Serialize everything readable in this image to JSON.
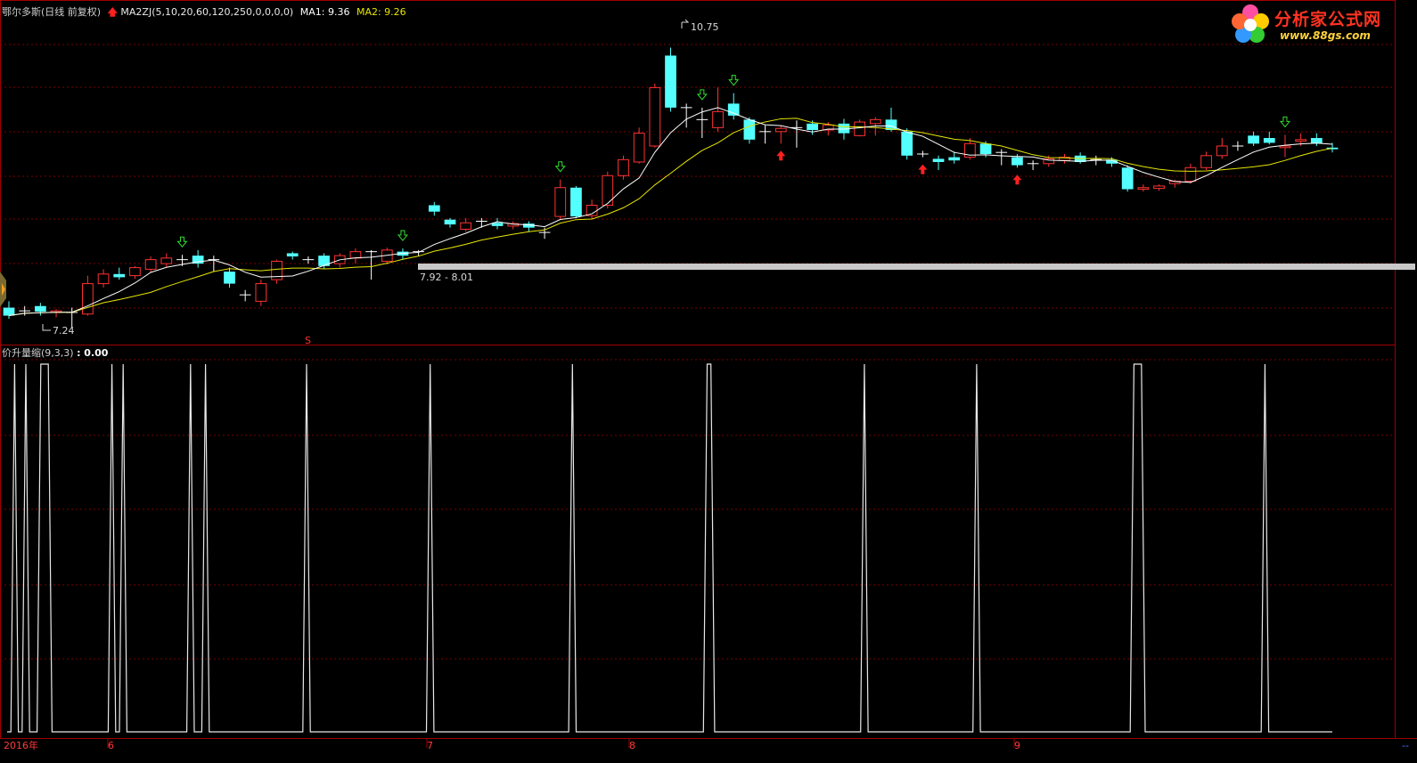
{
  "header": {
    "stock_title": "鄂尔多斯(日线 前复权)",
    "indicator_name": "MA2ZJ(5,10,20,60,120,250,0,0,0,0)",
    "ma1_label": "MA1: 9.36",
    "ma2_label": "MA2: 9.26"
  },
  "subchart": {
    "title": "价升量缩(9,3,3)",
    "value_label": ": 0.00"
  },
  "price_labels": {
    "high": "10.75",
    "low": "7.24",
    "zone": "7.92 - 8.01",
    "marker": "S"
  },
  "time_axis": {
    "year_label": "2016年",
    "months": [
      "6",
      "7",
      "8",
      "9"
    ],
    "corner_label": "--"
  },
  "logo": {
    "name": "分析家公式网",
    "url": "www.88gs.com"
  },
  "colors": {
    "up": "#ff3232",
    "down": "#54ffff",
    "ma1": "#ffffff",
    "ma2": "#e6e600",
    "grid": "#7a0000",
    "border": "#a00000",
    "indicator": "#ffffff",
    "band": "#c8c8c8",
    "buy_arrow": "#ff2020",
    "sell_arrow": "#33dd33"
  },
  "chart_data": {
    "type": "candlestick",
    "period": "daily",
    "high_label": 10.75,
    "low_label": 7.24,
    "zone": [
      7.92,
      8.01
    ],
    "ma_values": {
      "MA1": 9.36,
      "MA2": 9.26
    },
    "indicator": {
      "name": "价升量缩(9,3,3)",
      "current": 0.0,
      "values": [
        0,
        0,
        1,
        0,
        0,
        1,
        0,
        0,
        0,
        1,
        1,
        1,
        0,
        0,
        0,
        0,
        0,
        0,
        0,
        0,
        0,
        0,
        0,
        0,
        0,
        0,
        0,
        0,
        1,
        0,
        0,
        1,
        0,
        0,
        0,
        0,
        0,
        0,
        0,
        0,
        0,
        0,
        0,
        0,
        0,
        0,
        0,
        0,
        0,
        1,
        0,
        0,
        0,
        1,
        0,
        0,
        0,
        0,
        0,
        0,
        0,
        0,
        0,
        0,
        0,
        0,
        0,
        0,
        0,
        0,
        0,
        0,
        0,
        0,
        0,
        0,
        0,
        0,
        0,
        0,
        1,
        0,
        0,
        0,
        0,
        0,
        0,
        0,
        0,
        0,
        0,
        0,
        0,
        0,
        0,
        0,
        0,
        0,
        0,
        0,
        0,
        0,
        0,
        0,
        0,
        0,
        0,
        0,
        0,
        0,
        0,
        0,
        0,
        1,
        0,
        0,
        0,
        0,
        0,
        0,
        0,
        0,
        0,
        0,
        0,
        0,
        0,
        0,
        0,
        0,
        0,
        0,
        0,
        0,
        0,
        0,
        0,
        0,
        0,
        0,
        0,
        0,
        0,
        0,
        0,
        0,
        0,
        0,
        0,
        0,
        0,
        1,
        0,
        0,
        0,
        0,
        0,
        0,
        0,
        0,
        0,
        0,
        0,
        0,
        0,
        0,
        0,
        0,
        0,
        0,
        0,
        0,
        0,
        0,
        0,
        0,
        0,
        0,
        0,
        0,
        0,
        0,
        0,
        0,
        0,
        0,
        0,
        1,
        1,
        0,
        0,
        0,
        0,
        0,
        0,
        0,
        0,
        0,
        0,
        0,
        0,
        0,
        0,
        0,
        0,
        0,
        0,
        0,
        0,
        0,
        0,
        0,
        0,
        0,
        0,
        0,
        0,
        0,
        0,
        0,
        0,
        0,
        0,
        0,
        0,
        0,
        0,
        0,
        0,
        1,
        0,
        0,
        0,
        0,
        0,
        0,
        0,
        0,
        0,
        0,
        0,
        0,
        0,
        0,
        0,
        0,
        0,
        0,
        0,
        0,
        0,
        0,
        0,
        0,
        0,
        0,
        0,
        0,
        0,
        1,
        0,
        0,
        0,
        0,
        0,
        0,
        0,
        0,
        0,
        0,
        0,
        0,
        0,
        0,
        0,
        0,
        0,
        0,
        0,
        0,
        0,
        0,
        0,
        0,
        0,
        0,
        0,
        0,
        0,
        0,
        0,
        0,
        0,
        0,
        0,
        0,
        0,
        0,
        0,
        0,
        0,
        1,
        1,
        1,
        0,
        0,
        0,
        0,
        0,
        0,
        0,
        0,
        0,
        0,
        0,
        0,
        0,
        0,
        0,
        0,
        0,
        0,
        0,
        0,
        0,
        0,
        0,
        0,
        0,
        0,
        0,
        0,
        0,
        0,
        0,
        0,
        1,
        0,
        0,
        0,
        0,
        0,
        0,
        0,
        0,
        0,
        0,
        0,
        0,
        0,
        0,
        0,
        0,
        0,
        0
      ]
    },
    "candles": [
      {
        "o": 7.5,
        "h": 7.58,
        "l": 7.36,
        "c": 7.4,
        "s": "down"
      },
      {
        "o": 7.45,
        "h": 7.52,
        "l": 7.4,
        "c": 7.46,
        "s": "flat"
      },
      {
        "o": 7.52,
        "h": 7.56,
        "l": 7.4,
        "c": 7.45,
        "s": "down"
      },
      {
        "o": 7.44,
        "h": 7.48,
        "l": 7.38,
        "c": 7.46,
        "s": "up"
      },
      {
        "o": 7.42,
        "h": 7.5,
        "l": 7.24,
        "c": 7.44,
        "s": "flat"
      },
      {
        "o": 7.42,
        "h": 7.9,
        "l": 7.4,
        "c": 7.8,
        "s": "up"
      },
      {
        "o": 7.8,
        "h": 7.98,
        "l": 7.75,
        "c": 7.92,
        "s": "up"
      },
      {
        "o": 7.92,
        "h": 8.0,
        "l": 7.85,
        "c": 7.88,
        "s": "down"
      },
      {
        "o": 7.9,
        "h": 8.02,
        "l": 7.86,
        "c": 8.0,
        "s": "up"
      },
      {
        "o": 7.98,
        "h": 8.14,
        "l": 7.94,
        "c": 8.1,
        "s": "up"
      },
      {
        "o": 8.05,
        "h": 8.18,
        "l": 8.0,
        "c": 8.12,
        "s": "up"
      },
      {
        "o": 8.1,
        "h": 8.16,
        "l": 8.02,
        "c": 8.1,
        "s": "flat"
      },
      {
        "o": 8.15,
        "h": 8.22,
        "l": 8.0,
        "c": 8.05,
        "s": "down"
      },
      {
        "o": 8.05,
        "h": 8.15,
        "l": 7.95,
        "c": 8.1,
        "s": "flat"
      },
      {
        "o": 7.95,
        "h": 8.0,
        "l": 7.75,
        "c": 7.8,
        "s": "down"
      },
      {
        "o": 7.65,
        "h": 7.72,
        "l": 7.58,
        "c": 7.66,
        "s": "flat"
      },
      {
        "o": 7.58,
        "h": 7.85,
        "l": 7.52,
        "c": 7.8,
        "s": "up"
      },
      {
        "o": 7.85,
        "h": 8.1,
        "l": 7.8,
        "c": 8.08,
        "s": "up"
      },
      {
        "o": 8.18,
        "h": 8.2,
        "l": 8.1,
        "c": 8.14,
        "s": "down"
      },
      {
        "o": 8.1,
        "h": 8.14,
        "l": 8.05,
        "c": 8.1,
        "s": "flat"
      },
      {
        "o": 8.15,
        "h": 8.18,
        "l": 7.98,
        "c": 8.02,
        "s": "down"
      },
      {
        "o": 8.05,
        "h": 8.18,
        "l": 8.0,
        "c": 8.15,
        "s": "up"
      },
      {
        "o": 8.12,
        "h": 8.24,
        "l": 8.05,
        "c": 8.2,
        "s": "up"
      },
      {
        "o": 8.2,
        "h": 8.22,
        "l": 7.85,
        "c": 8.18,
        "s": "flat"
      },
      {
        "o": 8.08,
        "h": 8.25,
        "l": 8.04,
        "c": 8.22,
        "s": "up"
      },
      {
        "o": 8.2,
        "h": 8.24,
        "l": 8.1,
        "c": 8.15,
        "s": "down"
      },
      {
        "o": 8.18,
        "h": 8.22,
        "l": 8.14,
        "c": 8.2,
        "s": "flat"
      },
      {
        "o": 8.78,
        "h": 8.82,
        "l": 8.65,
        "c": 8.7,
        "s": "down"
      },
      {
        "o": 8.6,
        "h": 8.62,
        "l": 8.5,
        "c": 8.54,
        "s": "down"
      },
      {
        "o": 8.48,
        "h": 8.62,
        "l": 8.45,
        "c": 8.56,
        "s": "up"
      },
      {
        "o": 8.58,
        "h": 8.62,
        "l": 8.5,
        "c": 8.55,
        "s": "flat"
      },
      {
        "o": 8.56,
        "h": 8.62,
        "l": 8.48,
        "c": 8.52,
        "s": "down"
      },
      {
        "o": 8.52,
        "h": 8.58,
        "l": 8.48,
        "c": 8.55,
        "s": "up"
      },
      {
        "o": 8.55,
        "h": 8.58,
        "l": 8.45,
        "c": 8.5,
        "s": "down"
      },
      {
        "o": 8.44,
        "h": 8.5,
        "l": 8.36,
        "c": 8.44,
        "s": "flat"
      },
      {
        "o": 8.64,
        "h": 9.1,
        "l": 8.6,
        "c": 9.0,
        "s": "up"
      },
      {
        "o": 9.0,
        "h": 9.02,
        "l": 8.62,
        "c": 8.64,
        "s": "down"
      },
      {
        "o": 8.65,
        "h": 8.85,
        "l": 8.6,
        "c": 8.78,
        "s": "up"
      },
      {
        "o": 8.78,
        "h": 9.2,
        "l": 8.74,
        "c": 9.15,
        "s": "up"
      },
      {
        "o": 9.15,
        "h": 9.4,
        "l": 9.1,
        "c": 9.35,
        "s": "up"
      },
      {
        "o": 9.32,
        "h": 9.75,
        "l": 9.3,
        "c": 9.68,
        "s": "up"
      },
      {
        "o": 9.52,
        "h": 10.3,
        "l": 9.5,
        "c": 10.25,
        "s": "up"
      },
      {
        "o": 10.65,
        "h": 10.75,
        "l": 9.95,
        "c": 10.0,
        "s": "down"
      },
      {
        "o": 10.0,
        "h": 10.05,
        "l": 9.75,
        "c": 10.0,
        "s": "flat"
      },
      {
        "o": 9.85,
        "h": 10.0,
        "l": 9.62,
        "c": 9.8,
        "s": "flat"
      },
      {
        "o": 9.75,
        "h": 10.25,
        "l": 9.7,
        "c": 9.95,
        "s": "up"
      },
      {
        "o": 10.05,
        "h": 10.18,
        "l": 9.85,
        "c": 9.9,
        "s": "down"
      },
      {
        "o": 9.85,
        "h": 9.88,
        "l": 9.55,
        "c": 9.6,
        "s": "down"
      },
      {
        "o": 9.7,
        "h": 9.78,
        "l": 9.55,
        "c": 9.68,
        "s": "flat"
      },
      {
        "o": 9.7,
        "h": 9.78,
        "l": 9.55,
        "c": 9.74,
        "s": "up"
      },
      {
        "o": 9.75,
        "h": 9.84,
        "l": 9.5,
        "c": 9.74,
        "s": "flat"
      },
      {
        "o": 9.8,
        "h": 9.84,
        "l": 9.66,
        "c": 9.72,
        "s": "down"
      },
      {
        "o": 9.72,
        "h": 9.82,
        "l": 9.65,
        "c": 9.78,
        "s": "up"
      },
      {
        "o": 9.8,
        "h": 9.86,
        "l": 9.6,
        "c": 9.68,
        "s": "down"
      },
      {
        "o": 9.65,
        "h": 9.85,
        "l": 9.64,
        "c": 9.82,
        "s": "up"
      },
      {
        "o": 9.8,
        "h": 9.88,
        "l": 9.65,
        "c": 9.85,
        "s": "up"
      },
      {
        "o": 9.85,
        "h": 10.0,
        "l": 9.7,
        "c": 9.72,
        "s": "down"
      },
      {
        "o": 9.7,
        "h": 9.74,
        "l": 9.35,
        "c": 9.4,
        "s": "down"
      },
      {
        "o": 9.42,
        "h": 9.46,
        "l": 9.38,
        "c": 9.42,
        "s": "flat"
      },
      {
        "o": 9.36,
        "h": 9.4,
        "l": 9.22,
        "c": 9.32,
        "s": "down"
      },
      {
        "o": 9.38,
        "h": 9.45,
        "l": 9.3,
        "c": 9.34,
        "s": "down"
      },
      {
        "o": 9.38,
        "h": 9.62,
        "l": 9.35,
        "c": 9.55,
        "s": "up"
      },
      {
        "o": 9.55,
        "h": 9.58,
        "l": 9.38,
        "c": 9.42,
        "s": "down"
      },
      {
        "o": 9.44,
        "h": 9.48,
        "l": 9.28,
        "c": 9.36,
        "s": "flat"
      },
      {
        "o": 9.38,
        "h": 9.42,
        "l": 9.25,
        "c": 9.28,
        "s": "down"
      },
      {
        "o": 9.3,
        "h": 9.34,
        "l": 9.22,
        "c": 9.3,
        "s": "flat"
      },
      {
        "o": 9.3,
        "h": 9.4,
        "l": 9.26,
        "c": 9.36,
        "s": "up"
      },
      {
        "o": 9.34,
        "h": 9.42,
        "l": 9.3,
        "c": 9.38,
        "s": "up"
      },
      {
        "o": 9.4,
        "h": 9.44,
        "l": 9.3,
        "c": 9.32,
        "s": "down"
      },
      {
        "o": 9.33,
        "h": 9.4,
        "l": 9.28,
        "c": 9.35,
        "s": "flat"
      },
      {
        "o": 9.35,
        "h": 9.38,
        "l": 9.26,
        "c": 9.3,
        "s": "down"
      },
      {
        "o": 9.25,
        "h": 9.28,
        "l": 8.95,
        "c": 8.98,
        "s": "down"
      },
      {
        "o": 8.98,
        "h": 9.04,
        "l": 8.95,
        "c": 9.0,
        "s": "up"
      },
      {
        "o": 8.99,
        "h": 9.04,
        "l": 8.96,
        "c": 9.02,
        "s": "up"
      },
      {
        "o": 9.05,
        "h": 9.1,
        "l": 9.0,
        "c": 9.08,
        "s": "up"
      },
      {
        "o": 9.08,
        "h": 9.3,
        "l": 9.05,
        "c": 9.25,
        "s": "up"
      },
      {
        "o": 9.25,
        "h": 9.45,
        "l": 9.22,
        "c": 9.4,
        "s": "up"
      },
      {
        "o": 9.4,
        "h": 9.62,
        "l": 9.36,
        "c": 9.52,
        "s": "up"
      },
      {
        "o": 9.52,
        "h": 9.58,
        "l": 9.46,
        "c": 9.5,
        "s": "flat"
      },
      {
        "o": 9.65,
        "h": 9.7,
        "l": 9.52,
        "c": 9.55,
        "s": "down"
      },
      {
        "o": 9.62,
        "h": 9.7,
        "l": 9.54,
        "c": 9.56,
        "s": "down"
      },
      {
        "o": 9.5,
        "h": 9.66,
        "l": 9.38,
        "c": 9.52,
        "s": "up"
      },
      {
        "o": 9.58,
        "h": 9.68,
        "l": 9.52,
        "c": 9.6,
        "s": "up"
      },
      {
        "o": 9.62,
        "h": 9.68,
        "l": 9.52,
        "c": 9.55,
        "s": "down"
      },
      {
        "o": 9.5,
        "h": 9.56,
        "l": 9.44,
        "c": 9.48,
        "s": "down"
      }
    ],
    "buy_signals": [
      49,
      58,
      64
    ],
    "sell_signals": [
      11,
      25,
      35,
      44,
      46,
      81
    ]
  }
}
